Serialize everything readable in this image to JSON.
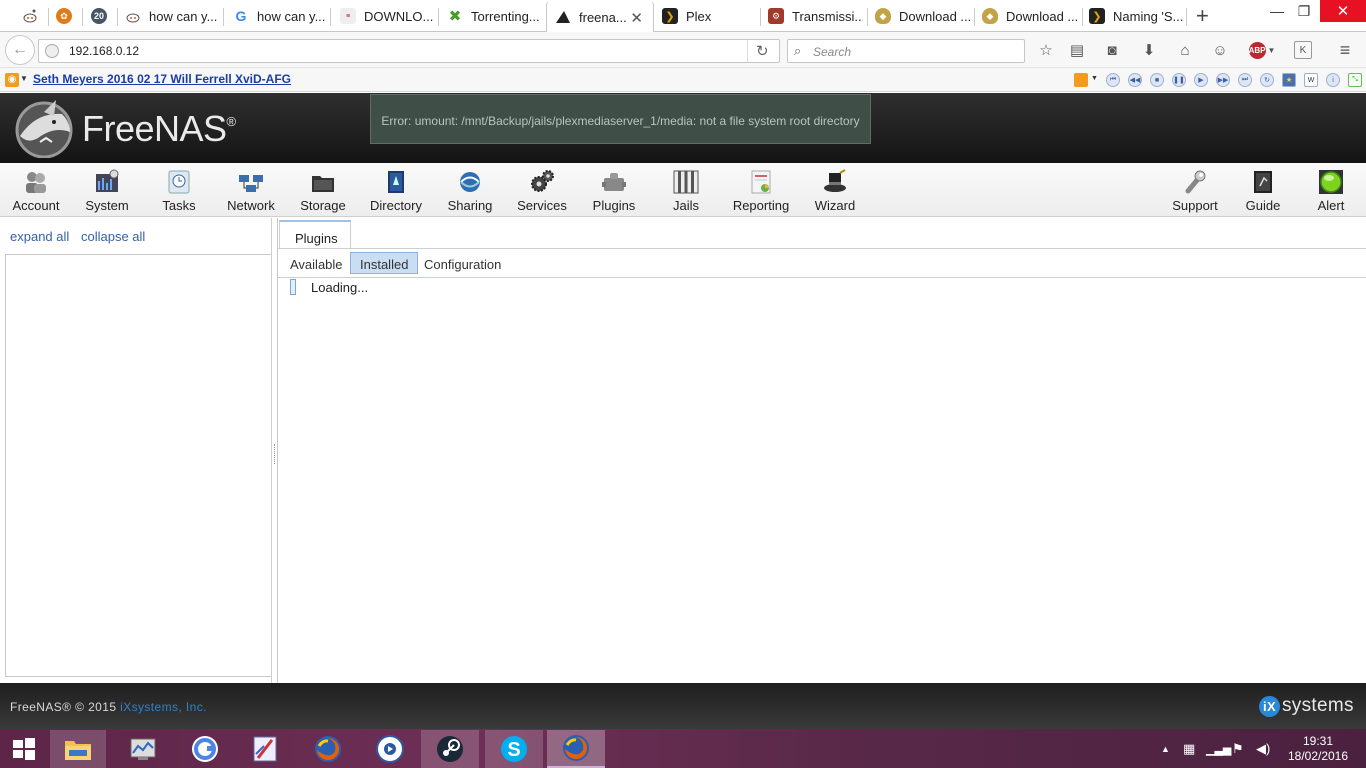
{
  "browser": {
    "tabs": [
      {
        "title": "",
        "icon": "reddit-alien-icon"
      },
      {
        "title": "",
        "icon": "orange-badge-icon"
      },
      {
        "title": "",
        "icon": "gear-badge-icon"
      },
      {
        "title": "how can y...",
        "icon": "reddit-alien-icon"
      },
      {
        "title": "how can y...",
        "icon": "google-g-icon"
      },
      {
        "title": "DOWNLO...",
        "icon": "site-favicon-icon"
      },
      {
        "title": "Torrenting...",
        "icon": "green-x-icon"
      },
      {
        "title": "freena...",
        "icon": "freenas-shark-icon"
      },
      {
        "title": "Plex",
        "icon": "plex-chevron-icon"
      },
      {
        "title": "Transmissi...",
        "icon": "transmission-icon"
      },
      {
        "title": "Download ...",
        "icon": "shield-badge-icon"
      },
      {
        "title": "Download ...",
        "icon": "shield-badge-icon"
      },
      {
        "title": "Naming 'S...",
        "icon": "plex-chevron-icon"
      }
    ],
    "url": "192.168.0.12",
    "search_placeholder": "Search",
    "bookmark_link": "Seth Meyers 2016 02 17 Will Ferrell XviD-AFG"
  },
  "freenas": {
    "logo_text": "FreeNAS",
    "logo_mark": "®",
    "error_message": "Error: umount: /mnt/Backup/jails/plexmediaserver_1/media: not a file system root directory",
    "toolbar": [
      "Account",
      "System",
      "Tasks",
      "Network",
      "Storage",
      "Directory",
      "Sharing",
      "Services",
      "Plugins",
      "Jails",
      "Reporting",
      "Wizard"
    ],
    "toolbar_right": [
      "Support",
      "Guide",
      "Alert"
    ],
    "tree_links": {
      "expand": "expand all",
      "collapse": "collapse all"
    },
    "main_tab": "Plugins",
    "subtabs": {
      "available": "Available",
      "installed": "Installed",
      "configuration": "Configuration"
    },
    "loading_text": "Loading...",
    "footer": {
      "copyright": "FreeNAS® © 2015 ",
      "company": "iXsystems, Inc.",
      "vendor_logo": "systems",
      "vendor_mark": "iX"
    }
  },
  "taskbar": {
    "time": "19:31",
    "date": "18/02/2016",
    "apps": [
      "file-explorer-icon",
      "resource-monitor-icon",
      "google-drive-icon",
      "paint-icon",
      "firefox-icon",
      "media-player-icon",
      "steam-icon",
      "skype-icon",
      "firefox-active-icon"
    ]
  },
  "colors": {
    "accent_link": "#3461a8",
    "error_bg": "#3f4f47",
    "header_bg": "#1f1f1f",
    "selected_subtab": "#c9ddf3"
  }
}
